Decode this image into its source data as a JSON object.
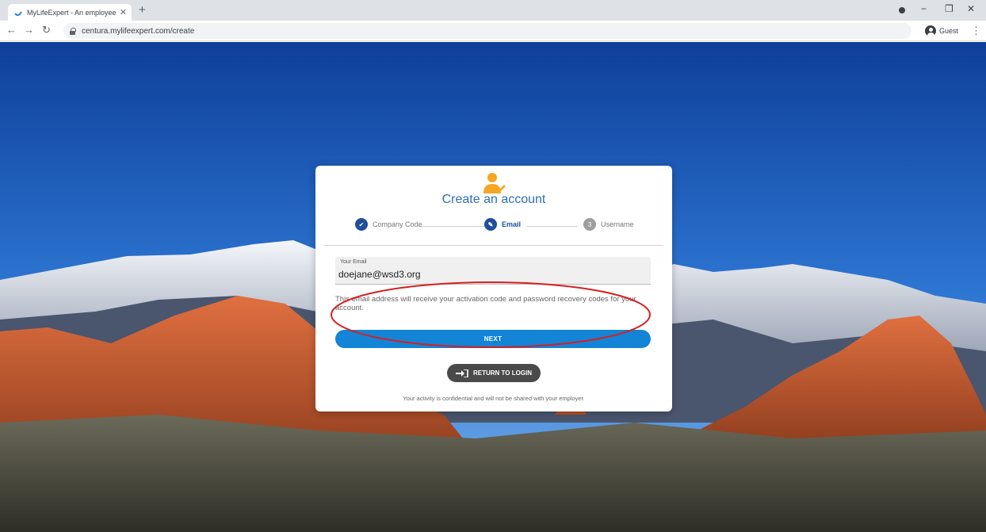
{
  "browser": {
    "tab_title": "MyLifeExpert - An employee wel",
    "new_tab": "+",
    "url": "centura.mylifeexpert.com/create",
    "profile_label": "Guest"
  },
  "card": {
    "title": "Create an account",
    "steps": [
      {
        "label": "Company Code",
        "state": "done"
      },
      {
        "label": "Email",
        "state": "active"
      },
      {
        "label": "Username",
        "state": "todo",
        "number": "3"
      }
    ],
    "email": {
      "label": "Your Email",
      "value": "doejane@wsd3.org"
    },
    "helper_text": "This email address will receive your activation code and password recovery codes for your account.",
    "next_label": "NEXT",
    "return_label": "RETURN TO LOGIN",
    "footnote": "Your activity is confidential and will not be shared with your employer."
  },
  "colors": {
    "primary": "#1384d6",
    "step_done": "#1f4e9c",
    "icon_accent": "#f5a623",
    "annotation": "#d62020"
  }
}
